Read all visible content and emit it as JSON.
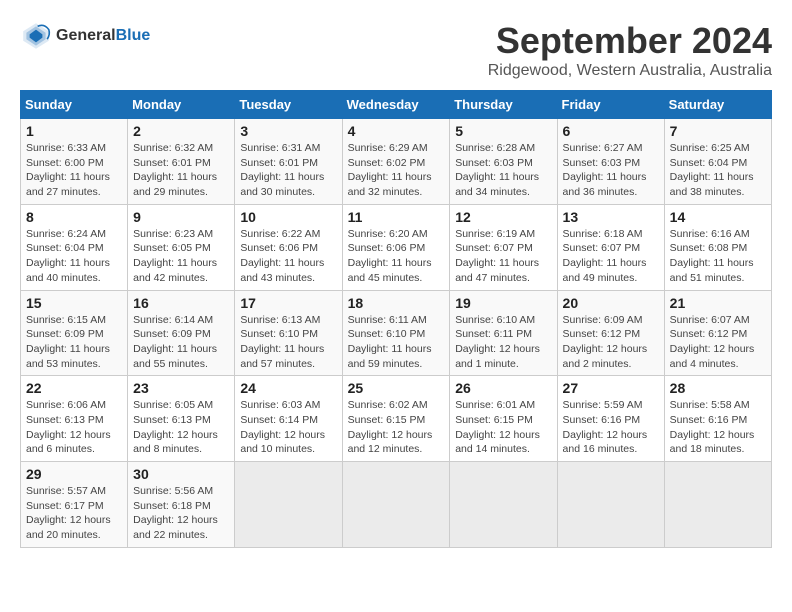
{
  "header": {
    "logo_general": "General",
    "logo_blue": "Blue",
    "title": "September 2024",
    "subtitle": "Ridgewood, Western Australia, Australia"
  },
  "days_of_week": [
    "Sunday",
    "Monday",
    "Tuesday",
    "Wednesday",
    "Thursday",
    "Friday",
    "Saturday"
  ],
  "weeks": [
    [
      {
        "day": "1",
        "info": "Sunrise: 6:33 AM\nSunset: 6:00 PM\nDaylight: 11 hours\nand 27 minutes."
      },
      {
        "day": "2",
        "info": "Sunrise: 6:32 AM\nSunset: 6:01 PM\nDaylight: 11 hours\nand 29 minutes."
      },
      {
        "day": "3",
        "info": "Sunrise: 6:31 AM\nSunset: 6:01 PM\nDaylight: 11 hours\nand 30 minutes."
      },
      {
        "day": "4",
        "info": "Sunrise: 6:29 AM\nSunset: 6:02 PM\nDaylight: 11 hours\nand 32 minutes."
      },
      {
        "day": "5",
        "info": "Sunrise: 6:28 AM\nSunset: 6:03 PM\nDaylight: 11 hours\nand 34 minutes."
      },
      {
        "day": "6",
        "info": "Sunrise: 6:27 AM\nSunset: 6:03 PM\nDaylight: 11 hours\nand 36 minutes."
      },
      {
        "day": "7",
        "info": "Sunrise: 6:25 AM\nSunset: 6:04 PM\nDaylight: 11 hours\nand 38 minutes."
      }
    ],
    [
      {
        "day": "8",
        "info": "Sunrise: 6:24 AM\nSunset: 6:04 PM\nDaylight: 11 hours\nand 40 minutes."
      },
      {
        "day": "9",
        "info": "Sunrise: 6:23 AM\nSunset: 6:05 PM\nDaylight: 11 hours\nand 42 minutes."
      },
      {
        "day": "10",
        "info": "Sunrise: 6:22 AM\nSunset: 6:06 PM\nDaylight: 11 hours\nand 43 minutes."
      },
      {
        "day": "11",
        "info": "Sunrise: 6:20 AM\nSunset: 6:06 PM\nDaylight: 11 hours\nand 45 minutes."
      },
      {
        "day": "12",
        "info": "Sunrise: 6:19 AM\nSunset: 6:07 PM\nDaylight: 11 hours\nand 47 minutes."
      },
      {
        "day": "13",
        "info": "Sunrise: 6:18 AM\nSunset: 6:07 PM\nDaylight: 11 hours\nand 49 minutes."
      },
      {
        "day": "14",
        "info": "Sunrise: 6:16 AM\nSunset: 6:08 PM\nDaylight: 11 hours\nand 51 minutes."
      }
    ],
    [
      {
        "day": "15",
        "info": "Sunrise: 6:15 AM\nSunset: 6:09 PM\nDaylight: 11 hours\nand 53 minutes."
      },
      {
        "day": "16",
        "info": "Sunrise: 6:14 AM\nSunset: 6:09 PM\nDaylight: 11 hours\nand 55 minutes."
      },
      {
        "day": "17",
        "info": "Sunrise: 6:13 AM\nSunset: 6:10 PM\nDaylight: 11 hours\nand 57 minutes."
      },
      {
        "day": "18",
        "info": "Sunrise: 6:11 AM\nSunset: 6:10 PM\nDaylight: 11 hours\nand 59 minutes."
      },
      {
        "day": "19",
        "info": "Sunrise: 6:10 AM\nSunset: 6:11 PM\nDaylight: 12 hours\nand 1 minute."
      },
      {
        "day": "20",
        "info": "Sunrise: 6:09 AM\nSunset: 6:12 PM\nDaylight: 12 hours\nand 2 minutes."
      },
      {
        "day": "21",
        "info": "Sunrise: 6:07 AM\nSunset: 6:12 PM\nDaylight: 12 hours\nand 4 minutes."
      }
    ],
    [
      {
        "day": "22",
        "info": "Sunrise: 6:06 AM\nSunset: 6:13 PM\nDaylight: 12 hours\nand 6 minutes."
      },
      {
        "day": "23",
        "info": "Sunrise: 6:05 AM\nSunset: 6:13 PM\nDaylight: 12 hours\nand 8 minutes."
      },
      {
        "day": "24",
        "info": "Sunrise: 6:03 AM\nSunset: 6:14 PM\nDaylight: 12 hours\nand 10 minutes."
      },
      {
        "day": "25",
        "info": "Sunrise: 6:02 AM\nSunset: 6:15 PM\nDaylight: 12 hours\nand 12 minutes."
      },
      {
        "day": "26",
        "info": "Sunrise: 6:01 AM\nSunset: 6:15 PM\nDaylight: 12 hours\nand 14 minutes."
      },
      {
        "day": "27",
        "info": "Sunrise: 5:59 AM\nSunset: 6:16 PM\nDaylight: 12 hours\nand 16 minutes."
      },
      {
        "day": "28",
        "info": "Sunrise: 5:58 AM\nSunset: 6:16 PM\nDaylight: 12 hours\nand 18 minutes."
      }
    ],
    [
      {
        "day": "29",
        "info": "Sunrise: 5:57 AM\nSunset: 6:17 PM\nDaylight: 12 hours\nand 20 minutes."
      },
      {
        "day": "30",
        "info": "Sunrise: 5:56 AM\nSunset: 6:18 PM\nDaylight: 12 hours\nand 22 minutes."
      },
      {
        "day": "",
        "info": ""
      },
      {
        "day": "",
        "info": ""
      },
      {
        "day": "",
        "info": ""
      },
      {
        "day": "",
        "info": ""
      },
      {
        "day": "",
        "info": ""
      }
    ]
  ]
}
